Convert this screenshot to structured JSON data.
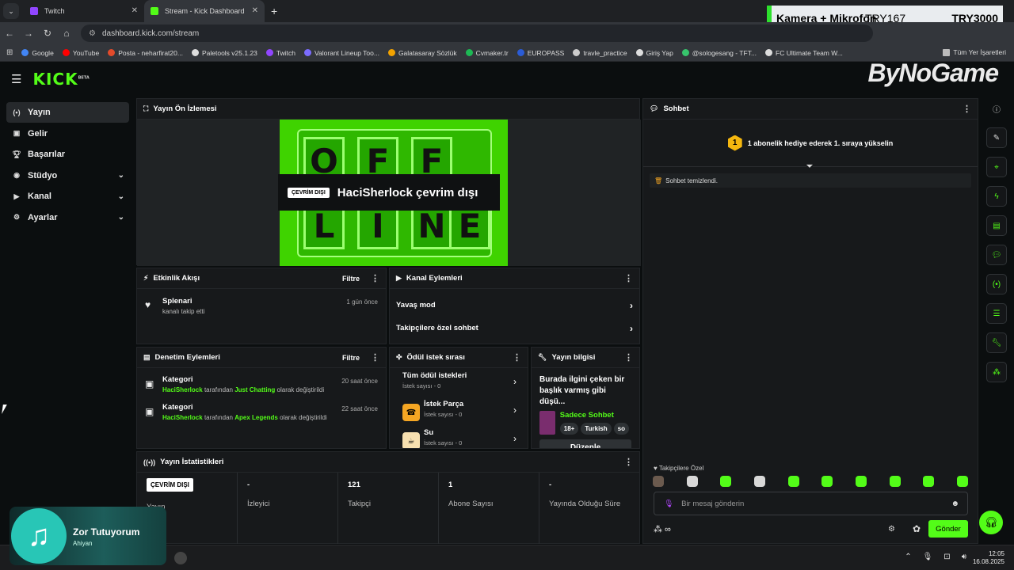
{
  "browser": {
    "tabs": [
      {
        "title": "Twitch",
        "active": false,
        "favicon": "twitch-icon"
      },
      {
        "title": "Stream - Kick Dashboard",
        "active": true,
        "favicon": "kick-icon"
      }
    ],
    "url": "dashboard.kick.com/stream",
    "bookmarks": [
      "Google",
      "YouTube",
      "Posta - neharfirat20...",
      "Paletools v25.1.23",
      "Twitch",
      "Valorant Lineup Too...",
      "Galatasaray Sözlük",
      "Cvmaker.tr",
      "EUROPASS",
      "travle_practice",
      "Giriş Yap",
      "@sologesang - TFT...",
      "FC Ultimate Team W..."
    ],
    "all_bookmarks": "Tüm Yer İşaretleri"
  },
  "overlay": {
    "label": "Kamera + Mikrofon",
    "v1": "TRY167",
    "v2": "TRY3000",
    "watermark": "ByNoGame"
  },
  "logo": "KICK",
  "logo_beta": "BETA",
  "sidebar": {
    "items": [
      {
        "label": "Yayın",
        "icon": "broadcast-icon",
        "active": true,
        "expandable": false
      },
      {
        "label": "Gelir",
        "icon": "income-icon",
        "active": false,
        "expandable": false
      },
      {
        "label": "Başarılar",
        "icon": "trophy-icon",
        "active": false,
        "expandable": false
      },
      {
        "label": "Stüdyo",
        "icon": "studio-icon",
        "active": false,
        "expandable": true
      },
      {
        "label": "Kanal",
        "icon": "channel-icon",
        "active": false,
        "expandable": true
      },
      {
        "label": "Ayarlar",
        "icon": "settings-icon",
        "active": false,
        "expandable": true
      }
    ]
  },
  "preview": {
    "title": "Yayın Ön İzlemesi",
    "badge": "ÇEVRİM DIŞI",
    "offline_text": "HaciSherlock çevrim dışı",
    "sign": [
      "O",
      "F",
      "F",
      "L",
      "I",
      "N",
      "E"
    ]
  },
  "activity": {
    "title": "Etkinlik Akışı",
    "filter": "Filtre",
    "items": [
      {
        "name": "Splenari",
        "text": "kanalı takip etti",
        "time": "1 gün önce"
      }
    ]
  },
  "channel_actions": {
    "title": "Kanal Eylemleri",
    "items": [
      "Yavaş mod",
      "Takipçilere özel sohbet"
    ]
  },
  "moderation": {
    "title": "Denetim Eylemleri",
    "filter": "Filtre",
    "items": [
      {
        "title": "Kategori",
        "user": "HaciSherlock",
        "mid": "tarafından",
        "category": "Just Chatting",
        "end": "olarak değiştirildi",
        "time": "20 saat önce"
      },
      {
        "title": "Kategori",
        "user": "HaciSherlock",
        "mid": "tarafından",
        "category": "Apex Legends",
        "end": "olarak değiştirildi",
        "time": "22 saat önce"
      }
    ]
  },
  "rewards": {
    "title": "Ödül istek sırası",
    "items": [
      {
        "title": "Tüm ödül istekleri",
        "sub": "İstek sayısı - 0"
      },
      {
        "title": "İstek Parça",
        "sub": "İstek sayısı - 0"
      },
      {
        "title": "Su",
        "sub": "İstek sayısı - 0"
      }
    ]
  },
  "stream_info": {
    "title": "Yayın bilgisi",
    "stream_title": "Burada ilgini çeken bir başlık varmış gibi düşü...",
    "category": "Sadece Sohbet",
    "tags": [
      "18+",
      "Turkish",
      "so"
    ],
    "edit": "Düzenle"
  },
  "stats": {
    "title": "Yayın İstatistikleri",
    "items": [
      {
        "value": "ÇEVRİM DIŞI",
        "label": "Yayın"
      },
      {
        "value": "-",
        "label": "İzleyici"
      },
      {
        "value": "121",
        "label": "Takipçi"
      },
      {
        "value": "1",
        "label": "Abone Sayısı"
      },
      {
        "value": "-",
        "label": "Yayında Olduğu Süre"
      }
    ]
  },
  "chat": {
    "title": "Sohbet",
    "sub_rank": "1",
    "sub_text": "1 abonelik hediye ederek 1. sıraya yükselin",
    "cleared": "Sohbet temizlendi.",
    "emote_label": "Takipçilere Özel",
    "placeholder": "Bir mesaj gönderin",
    "send": "Gönder"
  },
  "music": {
    "song": "Zor Tutuyorum",
    "artist": "Ahiyan"
  },
  "clock": {
    "time": "12:05",
    "date": "16.08.2025"
  },
  "colors": {
    "accent": "#53fc18",
    "bg": "#0b0e0f",
    "panel": "#17191b"
  }
}
